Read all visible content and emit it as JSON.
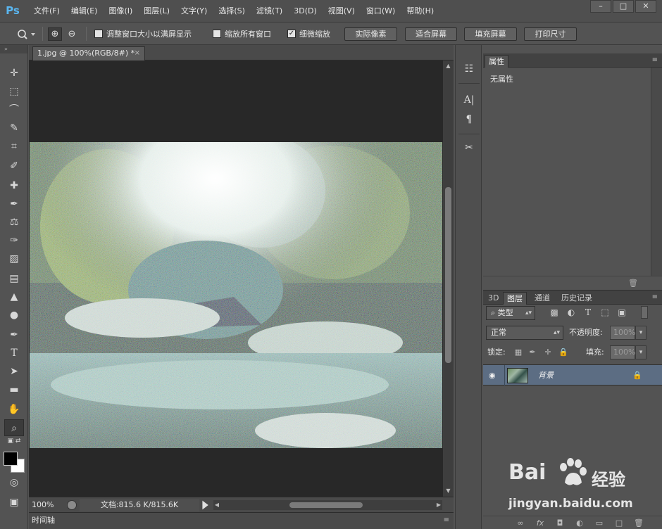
{
  "app": {
    "logo": "Ps",
    "menu": [
      "文件(F)",
      "编辑(E)",
      "图像(I)",
      "图层(L)",
      "文字(Y)",
      "选择(S)",
      "滤镜(T)",
      "3D(D)",
      "视图(V)",
      "窗口(W)",
      "帮助(H)"
    ]
  },
  "options": {
    "fit_window_label": "调整窗口大小以满屏显示",
    "fit_window_checked": false,
    "zoom_all_label": "缩放所有窗口",
    "zoom_all_checked": false,
    "scrubby_label": "细微缩放",
    "scrubby_checked": true,
    "check_mark": "✓",
    "actual_pixels": "实际像素",
    "fit_screen": "适合屏幕",
    "fill_screen": "填充屏幕",
    "print_size": "打印尺寸"
  },
  "document": {
    "tab_title": "1.jpg @ 100%(RGB/8#) *",
    "close_glyph": "×",
    "zoom": "100%",
    "doc_size": "文档:815.6 K/815.6K",
    "timeline_tab": "时间轴"
  },
  "properties": {
    "tab": "属性",
    "empty_text": "无属性"
  },
  "layers": {
    "tabs": [
      "3D",
      "图层",
      "通道",
      "历史记录"
    ],
    "filter_kind": "类型",
    "blend_mode": "正常",
    "opacity_label": "不透明度:",
    "opacity_value": "100%",
    "lock_label": "锁定:",
    "fill_label": "填充:",
    "fill_value": "100%",
    "items": [
      {
        "name": "背景",
        "visible": true,
        "locked": true
      }
    ]
  },
  "watermark": {
    "brand_left": "Bai",
    "brand_right": "经验",
    "url": "jingyan.baidu.com"
  },
  "colors": {
    "accent": "#5ab6f0",
    "selected_layer": "#5c6d83",
    "canvas_bg": "#282828"
  }
}
